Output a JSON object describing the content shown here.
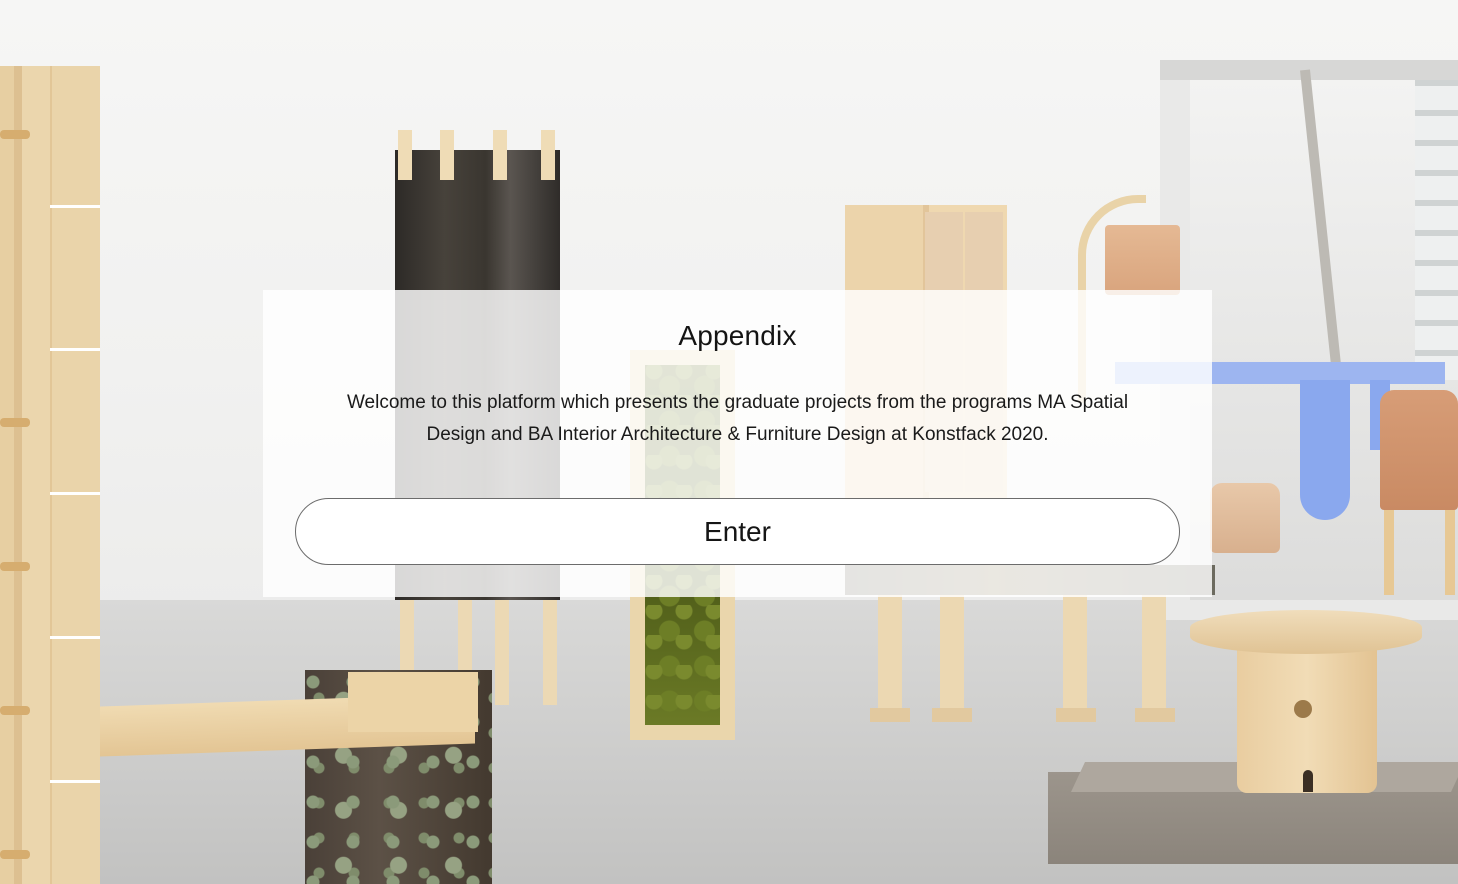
{
  "modal": {
    "title": "Appendix",
    "body": "Welcome to this platform which presents the graduate projects from the programs MA Spatial Design and BA Interior Architecture & Furniture Design at Konstfack 2020.",
    "enter_label": "Enter"
  },
  "background": {
    "photo": "exhibition-hall-photo"
  },
  "colors": {
    "modal_bg": "#ffffff",
    "text": "#141414",
    "button_border": "#6c6c6c"
  }
}
